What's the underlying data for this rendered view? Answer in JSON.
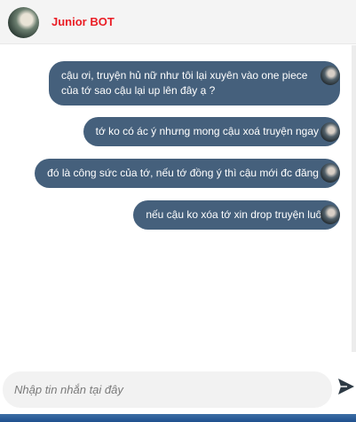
{
  "header": {
    "title": "Junior BOT"
  },
  "messages": [
    {
      "text": "cậu ơi, truyện hủ nữ như tôi lại xuyên vào one piece của tớ sao cậu lại up lên đây ạ ?"
    },
    {
      "text": "tớ ko có ác ý nhưng mong cậu xoá  truyện ngay ạ"
    },
    {
      "text": "đó là công sức của tớ, nếu tớ đồng ý thì cậu mới đc đăng ạ"
    },
    {
      "text": "nếu cậu ko xóa tớ xin drop truyện luôn"
    }
  ],
  "composer": {
    "placeholder": "Nhập tin nhắn tại đây"
  },
  "colors": {
    "title": "#ea1d25",
    "bubble": "#45607c"
  },
  "icons": {
    "send": "send-icon"
  }
}
